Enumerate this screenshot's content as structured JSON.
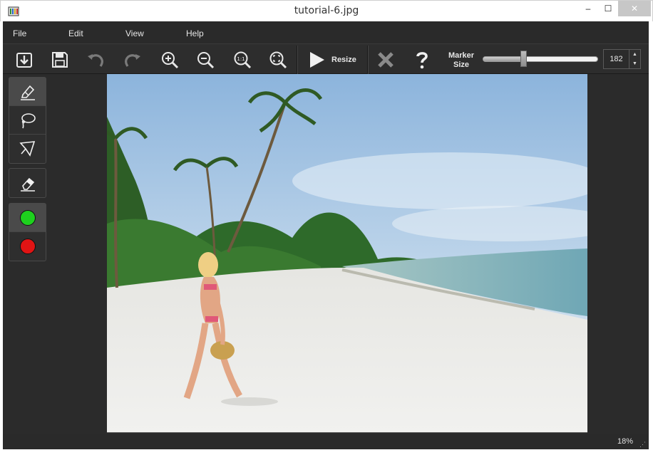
{
  "window": {
    "title": "tutorial-6.jpg",
    "minimize_glyph": "‒",
    "maximize_glyph": "☐",
    "close_glyph": "✕"
  },
  "menu": [
    "File",
    "Edit",
    "View",
    "Help"
  ],
  "toolbar": {
    "resize_label": "Resize",
    "marker_label_line1": "Marker",
    "marker_label_line2": "Size",
    "marker_size_value": "182",
    "marker_size_fraction": 0.37,
    "spin_up_glyph": "▲",
    "spin_down_glyph": "▼",
    "icons": [
      "open-file-icon",
      "save-icon",
      "undo-icon",
      "redo-icon",
      "zoom-in-icon",
      "zoom-out-icon",
      "zoom-actual-size-icon",
      "zoom-fit-icon",
      "play-icon",
      "cancel-icon",
      "help-icon"
    ]
  },
  "tools": {
    "icons": [
      "marker-pen-icon",
      "lasso-icon",
      "polygon-lasso-icon",
      "eraser-icon"
    ],
    "colors": {
      "keep": "#1ed01e",
      "remove": "#e01414"
    }
  },
  "status": {
    "zoom": "18%",
    "grip_glyph": "⋰"
  },
  "colors": {
    "background_dark": "#2b2b2b",
    "text_light": "#e6e6e6"
  }
}
